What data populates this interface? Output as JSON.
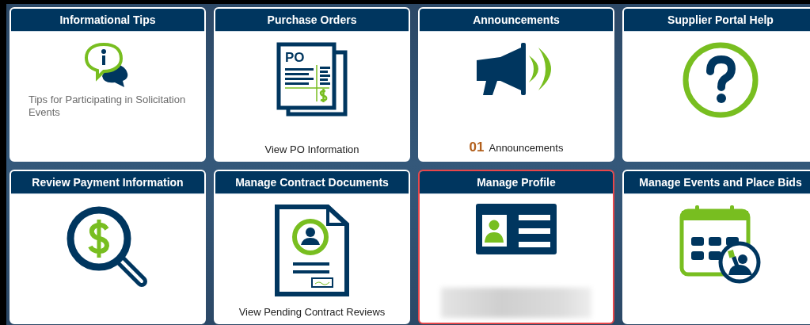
{
  "tiles": [
    {
      "title": "Informational Tips",
      "kind": "info-bubble",
      "selected": false,
      "caption": {
        "kind": "description",
        "text": "Tips for Participating in Solicitation Events"
      }
    },
    {
      "title": "Purchase Orders",
      "kind": "po-document",
      "icon_label": "PO",
      "selected": false,
      "caption": {
        "kind": "link",
        "text": "View PO Information"
      }
    },
    {
      "title": "Announcements",
      "kind": "megaphone",
      "selected": false,
      "count": "01",
      "caption": {
        "kind": "link",
        "text": "Announcements"
      }
    },
    {
      "title": "Supplier Portal Help",
      "kind": "help",
      "selected": false
    },
    {
      "title": "Review Payment Information",
      "kind": "payment-search",
      "selected": false
    },
    {
      "title": "Manage Contract Documents",
      "kind": "contract",
      "selected": false,
      "caption": {
        "kind": "link",
        "text": "View Pending Contract Reviews"
      }
    },
    {
      "title": "Manage Profile",
      "kind": "id-card",
      "selected": true,
      "redacted": true
    },
    {
      "title": "Manage Events and Place Bids",
      "kind": "calendar",
      "selected": false
    }
  ]
}
